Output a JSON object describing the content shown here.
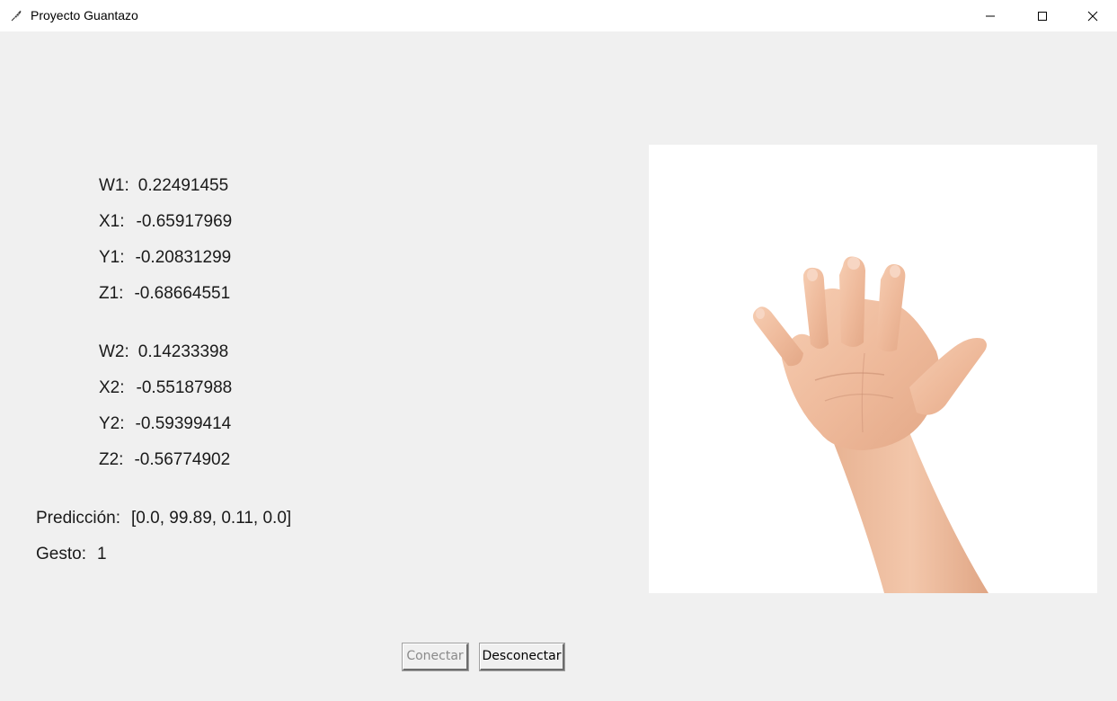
{
  "window": {
    "title": "Proyecto Guantazo",
    "icon": "feather-icon",
    "controls": {
      "minimize_icon": "minimize-icon",
      "maximize_icon": "maximize-icon",
      "close_icon": "close-icon"
    }
  },
  "sensors": {
    "glove1": {
      "w_label": "W1:",
      "w_value": "0.22491455",
      "x_label": "X1:",
      "x_value": "-0.65917969",
      "y_label": "Y1:",
      "y_value": "-0.20831299",
      "z_label": "Z1:",
      "z_value": "-0.68664551"
    },
    "glove2": {
      "w_label": "W2:",
      "w_value": "0.14233398",
      "x_label": "X2:",
      "x_value": "-0.55187988",
      "y_label": "Y2:",
      "y_value": "-0.59399414",
      "z_label": "Z2:",
      "z_value": "-0.56774902"
    }
  },
  "result": {
    "prediction_label": "Predicción:",
    "prediction_value": "[0.0, 99.89, 0.11, 0.0]",
    "gesture_label": "Gesto:",
    "gesture_value": "1"
  },
  "gesture_image": {
    "icon": "open-hand-image"
  },
  "buttons": {
    "connect_label": "Conectar",
    "connect_enabled": false,
    "disconnect_label": "Desconectar",
    "disconnect_enabled": true
  },
  "colors": {
    "background": "#f0f0f0",
    "titlebar": "#ffffff",
    "disabled_text": "#8a8a8a",
    "skin": "#f2c2a4"
  }
}
